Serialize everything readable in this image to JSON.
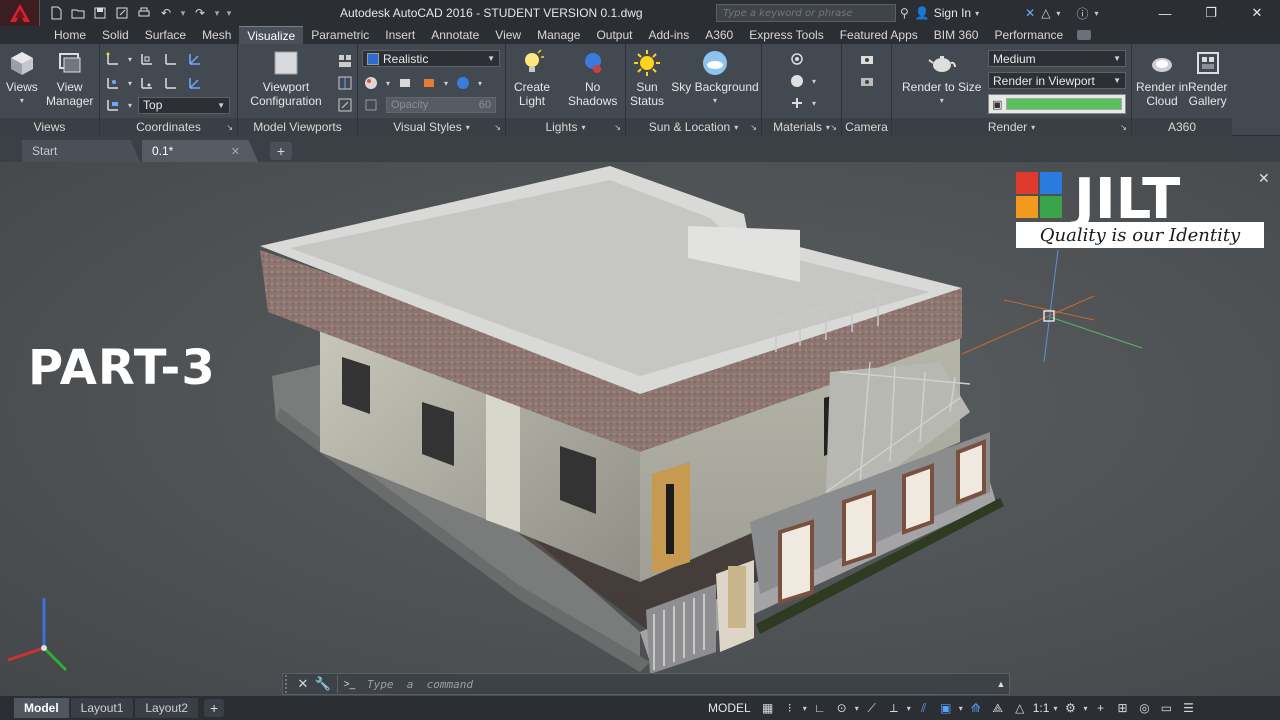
{
  "window": {
    "title": "Autodesk AutoCAD 2016 - STUDENT VERSION    0.1.dwg",
    "search_placeholder": "Type a keyword or phrase",
    "signin_label": "Sign In"
  },
  "ribbon_tabs": [
    "Home",
    "Solid",
    "Surface",
    "Mesh",
    "Visualize",
    "Parametric",
    "Insert",
    "Annotate",
    "View",
    "Manage",
    "Output",
    "Add-ins",
    "A360",
    "Express Tools",
    "Featured Apps",
    "BIM 360",
    "Performance"
  ],
  "active_tab": "Visualize",
  "ribbon": {
    "views": {
      "views_label": "Views",
      "view_manager_line1": "View",
      "view_manager_line2": "Manager",
      "title": "Views"
    },
    "coordinates": {
      "top_label": "Top",
      "title": "Coordinates"
    },
    "model_viewports": {
      "config_line1": "Viewport",
      "config_line2": "Configuration",
      "title": "Model Viewports"
    },
    "visual_styles": {
      "style_value": "Realistic",
      "opacity_label": "Opacity",
      "opacity_value": "60",
      "title": "Visual Styles"
    },
    "lights": {
      "create_light_line1": "Create",
      "create_light_line2": "Light",
      "no_shadows_line1": "No",
      "no_shadows_line2": "Shadows",
      "title": "Lights"
    },
    "sun_location": {
      "sun_status_line1": "Sun",
      "sun_status_line2": "Status",
      "sky_background": "Sky Background",
      "title": "Sun & Location"
    },
    "materials": {
      "title": "Materials"
    },
    "camera": {
      "title": "Camera"
    },
    "render": {
      "render_to_size": "Render to Size",
      "quality_value": "Medium",
      "render_location": "Render in Viewport",
      "render_progress_percent": 100,
      "title": "Render"
    },
    "a360": {
      "render_cloud_line1": "Render in",
      "render_cloud_line2": "Cloud",
      "render_gallery_line1": "Render",
      "render_gallery_line2": "Gallery",
      "title": "A360"
    }
  },
  "doc_tabs": {
    "start": "Start",
    "drawing": "0.1*"
  },
  "viewport": {
    "part_label": "PART-3",
    "watermark_word": "JILT",
    "watermark_tagline": "Quality is our Identity"
  },
  "command_line": {
    "placeholder": "Type  a  command"
  },
  "layout_tabs": [
    "Model",
    "Layout1",
    "Layout2"
  ],
  "status": {
    "model_space": "MODEL",
    "scale": "1:1"
  },
  "colors": {
    "title_bar": "#2b2f34",
    "ribbon": "#434950",
    "viewport": "#54575a",
    "accent_red": "#c8202c",
    "render_progress": "#59c059"
  },
  "icons": [
    "autocad-logo-icon",
    "new-icon",
    "open-icon",
    "save-icon",
    "saveas-icon",
    "print-icon",
    "undo-icon",
    "redo-icon",
    "binoculars-icon",
    "user-icon",
    "exchange-icon",
    "a360-icon",
    "help-icon",
    "sun-icon",
    "sky-icon",
    "lightbulb-icon",
    "teapot-icon",
    "camera-icon",
    "ucs-icon"
  ]
}
